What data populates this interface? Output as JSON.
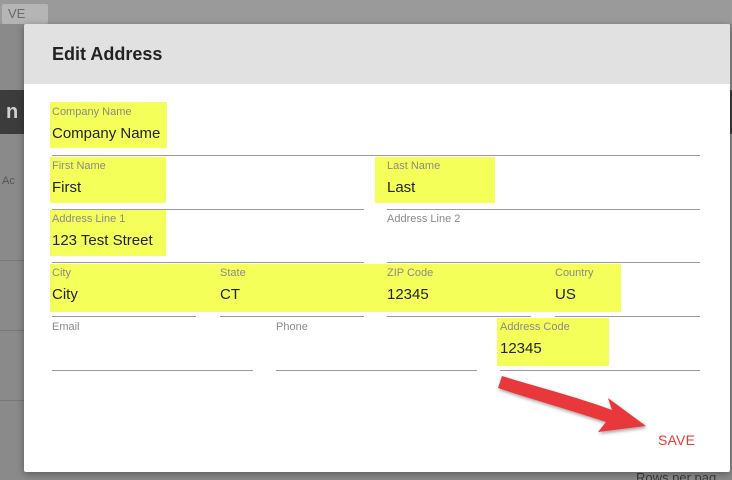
{
  "background": {
    "chip_text": "VE",
    "left_dark_text": "n",
    "left_text": "Ac",
    "rows_per_page": "Rows per pag"
  },
  "dialog": {
    "title": "Edit Address",
    "save_label": "SAVE"
  },
  "fields": {
    "company_name": {
      "label": "Company Name",
      "value": "Company Name"
    },
    "first_name": {
      "label": "First Name",
      "value": "First"
    },
    "last_name": {
      "label": "Last Name",
      "value": "Last"
    },
    "address_line_1": {
      "label": "Address Line 1",
      "value": "123 Test Street"
    },
    "address_line_2": {
      "label": "Address Line 2",
      "value": ""
    },
    "city": {
      "label": "City",
      "value": "City"
    },
    "state": {
      "label": "State",
      "value": "CT"
    },
    "zip_code": {
      "label": "ZIP Code",
      "value": "12345"
    },
    "country": {
      "label": "Country",
      "value": "US"
    },
    "email": {
      "label": "Email",
      "value": ""
    },
    "phone": {
      "label": "Phone",
      "value": ""
    },
    "address_code": {
      "label": "Address Code",
      "value": "12345"
    }
  },
  "colors": {
    "highlight": "#f5ff5a",
    "save": "#e53935",
    "arrow": "#e8383a"
  }
}
